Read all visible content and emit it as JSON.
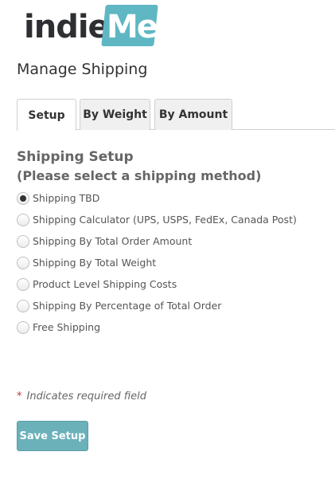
{
  "logo": {
    "part1": "indie",
    "part2": "Me"
  },
  "page_title": "Manage Shipping",
  "tabs": [
    {
      "label": "Setup",
      "active": true
    },
    {
      "label": "By Weight",
      "active": false
    },
    {
      "label": "By Amount",
      "active": false
    }
  ],
  "section": {
    "title": "Shipping Setup",
    "subtitle": "(Please select a shipping method)"
  },
  "shipping_methods": [
    {
      "label": "Shipping TBD",
      "selected": true
    },
    {
      "label": "Shipping Calculator (UPS, USPS, FedEx, Canada Post)",
      "selected": false
    },
    {
      "label": "Shipping By Total Order Amount",
      "selected": false
    },
    {
      "label": "Shipping By Total Weight",
      "selected": false
    },
    {
      "label": "Product Level Shipping Costs",
      "selected": false
    },
    {
      "label": "Shipping By Percentage of Total Order",
      "selected": false
    },
    {
      "label": "Free Shipping",
      "selected": false
    }
  ],
  "required_note": {
    "star": "*",
    "text": "Indicates required field"
  },
  "save_button": {
    "label": "Save Setup"
  },
  "colors": {
    "brand_teal": "#5fb7c3",
    "button": "#6ab1ba",
    "required_star": "#c0392b"
  }
}
